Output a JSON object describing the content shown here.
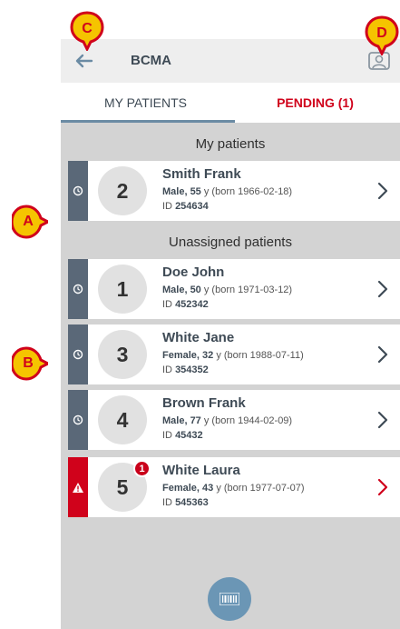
{
  "appbar": {
    "title": "BCMA",
    "back_icon": "arrow-left-icon",
    "account_icon": "user-badge-icon"
  },
  "tabs": [
    {
      "label": "MY PATIENTS",
      "active": true
    },
    {
      "label": "PENDING (1)",
      "active": false
    }
  ],
  "sections": {
    "my_patients": "My patients",
    "unassigned": "Unassigned patients"
  },
  "patients": [
    {
      "number": "2",
      "name": "Smith Frank",
      "gender_age": "Male, 55",
      "born": " y (born 1966-02-18)",
      "id_label": "ID ",
      "id": "254634",
      "status": "clock"
    },
    {
      "number": "1",
      "name": "Doe John",
      "gender_age": "Male, 50",
      "born": " y (born 1971-03-12)",
      "id_label": "ID ",
      "id": "452342",
      "status": "clock"
    },
    {
      "number": "3",
      "name": "White Jane",
      "gender_age": "Female, 32",
      "born": " y (born 1988-07-11)",
      "id_label": "ID ",
      "id": "354352",
      "status": "clock"
    },
    {
      "number": "4",
      "name": "Brown Frank",
      "gender_age": "Male, 77",
      "born": " y (born 1944-02-09)",
      "id_label": "ID ",
      "id": "45432",
      "status": "clock"
    },
    {
      "number": "5",
      "name": "White Laura",
      "gender_age": "Female, 43",
      "born": " y (born 1977-07-07)",
      "id_label": "ID ",
      "id": "545363",
      "status": "alert",
      "badge": "1"
    }
  ],
  "callouts": [
    "A",
    "B",
    "C",
    "D"
  ],
  "colors": {
    "accent": "#d0021b",
    "strip": "#5a6878",
    "scan_button": "#6b96b5",
    "callout_fill": "#f5c400"
  },
  "scan_icon": "barcode-icon"
}
